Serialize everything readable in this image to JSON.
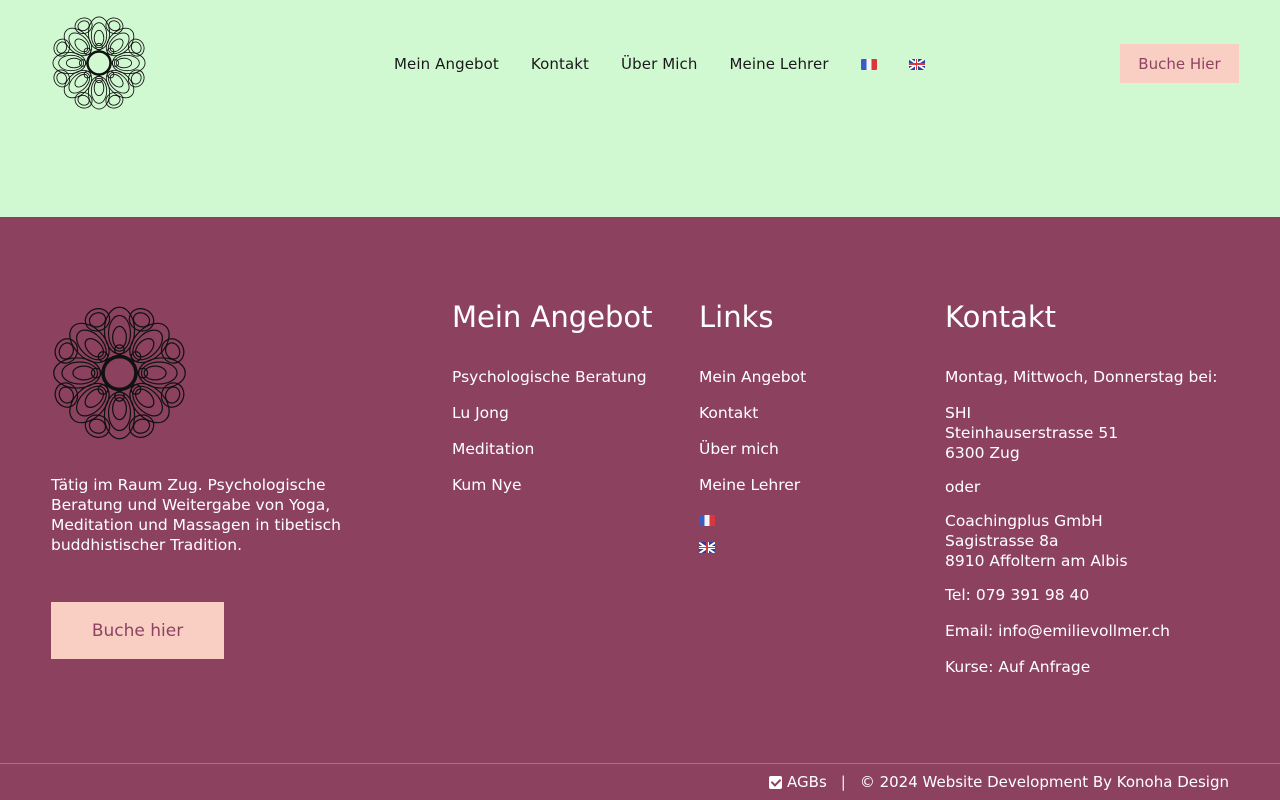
{
  "header": {
    "nav": [
      "Mein Angebot",
      "Kontakt",
      "Über Mich",
      "Meine Lehrer"
    ],
    "book_label": "Buche Hier"
  },
  "footer": {
    "about": "Tätig im Raum Zug. Psychologische Beratung und Weitergabe von Yoga, Meditation und Massagen in tibetisch buddhistischer Tradition.",
    "book_label": "Buche hier",
    "offer": {
      "title": "Mein Angebot",
      "items": [
        "Psychologische Beratung",
        "Lu Jong",
        "Meditation",
        "Kum Nye"
      ]
    },
    "links": {
      "title": "Links",
      "items": [
        "Mein Angebot",
        "Kontakt",
        "Über mich",
        "Meine Lehrer"
      ]
    },
    "contact": {
      "title": "Kontakt",
      "days": "Montag, Mittwoch, Donnerstag bei:",
      "loc1_name": "SHI",
      "loc1_street": "Steinhauserstrasse 51",
      "loc1_city": "6300 Zug",
      "or": "oder",
      "loc2_name": "Coachingplus GmbH",
      "loc2_street": "Sagistrasse 8a",
      "loc2_city": "8910 Affoltern am Albis",
      "tel": "Tel: 079 391 98 40",
      "email": "Email: info@emilievollmer.ch",
      "courses": "Kurse: Auf Anfrage"
    },
    "bottom": {
      "agb": "AGBs",
      "separator": "|",
      "copyright": "© 2024 Website Development By Konoha Design"
    }
  },
  "icons": {
    "logo": "mandala-flower-icon",
    "flag_fr": "flag-france-icon",
    "flag_gb": "flag-uk-icon",
    "checkbox": "checkbox-checked-icon"
  },
  "colors": {
    "header_bg": "#d1f9d1",
    "footer_bg": "#8c425e",
    "button_bg": "#f9cfc4",
    "button_text": "#8d4360"
  }
}
